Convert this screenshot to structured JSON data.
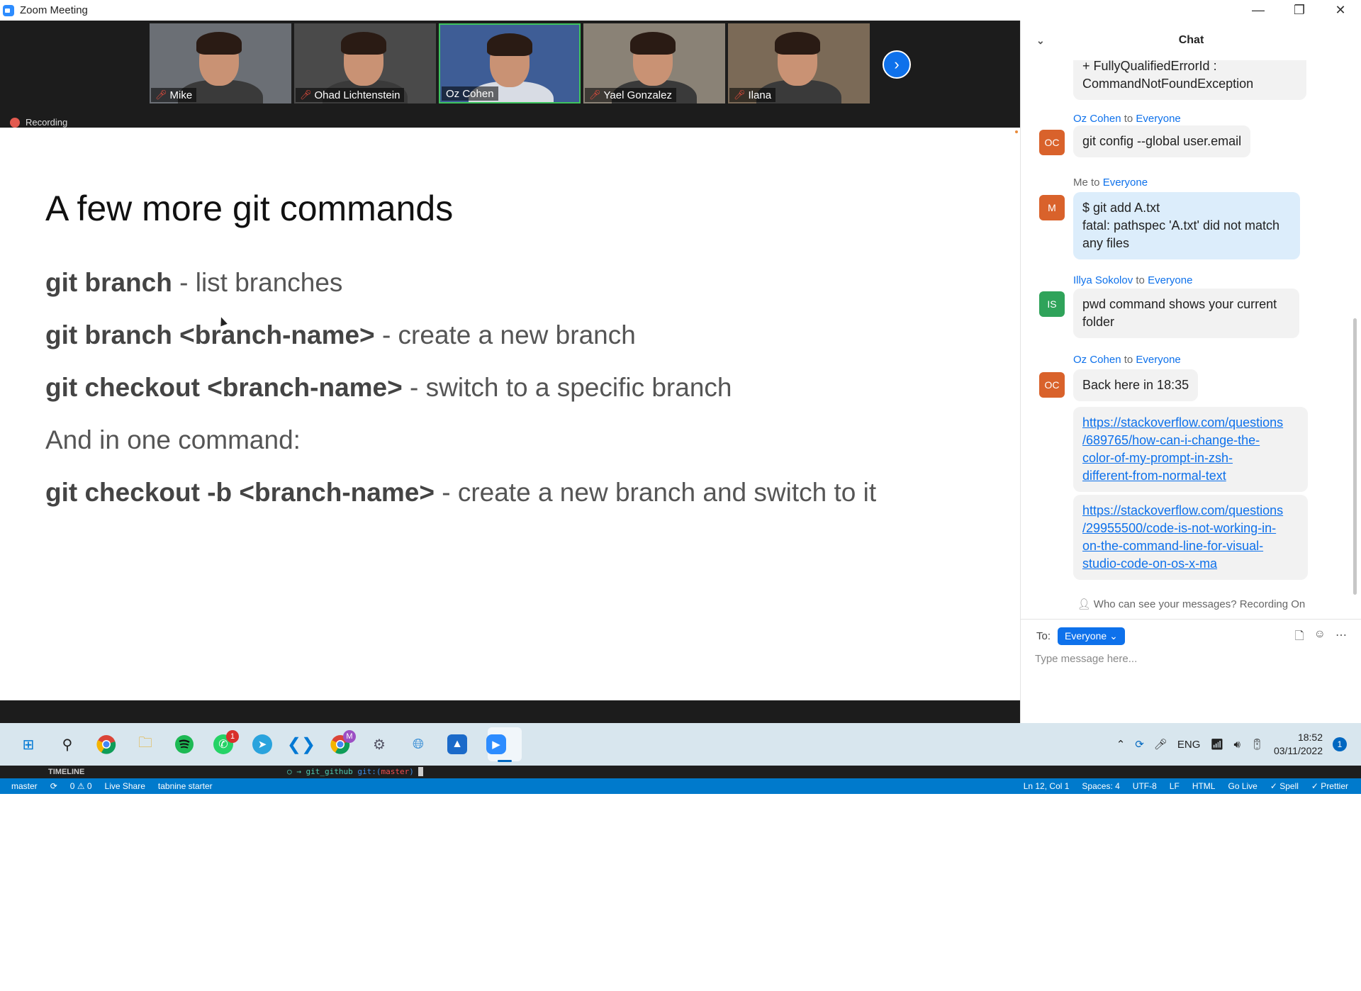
{
  "window": {
    "title": "Zoom Meeting",
    "controls": [
      "minimize",
      "maximize",
      "close"
    ]
  },
  "participants": [
    {
      "name": "Mike",
      "muted": true,
      "speaking": false,
      "bg": "#6b6f75"
    },
    {
      "name": "Ohad Lichtenstein",
      "muted": true,
      "speaking": false,
      "bg": "#4a4a4a"
    },
    {
      "name": "Oz Cohen",
      "muted": false,
      "speaking": true,
      "bg": "#3e5d96"
    },
    {
      "name": "Yael Gonzalez",
      "muted": true,
      "speaking": false,
      "bg": "#8a8276"
    },
    {
      "name": "Ilana",
      "muted": true,
      "speaking": false,
      "bg": "#7b6a57"
    }
  ],
  "recording": {
    "label": "Recording"
  },
  "slide": {
    "heading": "A few more git commands",
    "lines": [
      {
        "bold": "git branch",
        "rest": " - list branches"
      },
      {
        "bold": "git branch <branch-name>",
        "rest": " - create a new branch"
      },
      {
        "bold": "git checkout <branch-name>",
        "rest": " - switch to a specific branch"
      },
      {
        "bold": "",
        "rest": "And in one command:"
      },
      {
        "bold": "git checkout -b <branch-name>",
        "rest": " - create a new branch and switch to it"
      }
    ]
  },
  "chat": {
    "title": "Chat",
    "messages": [
      {
        "text": "+ FullyQualifiedErrorId : CommandNotFoundException",
        "kind": "partial"
      },
      {
        "sender": "Oz Cohen",
        "to_word": "to",
        "audience": "Everyone",
        "initials": "OC",
        "avatar_color": "#d9622b",
        "text": "git config --global user.email"
      },
      {
        "sender": "Me",
        "to_word": "to",
        "audience": "Everyone",
        "initials": "M",
        "avatar_color": "#d9622b",
        "text": "$ git add A.txt\nfatal: pathspec 'A.txt' did not match any files"
      },
      {
        "sender": "Illya Sokolov",
        "to_word": "to",
        "audience": "Everyone",
        "initials": "IS",
        "avatar_color": "#2fa35a",
        "text": "pwd command shows your current folder"
      },
      {
        "sender": "Oz Cohen",
        "to_word": "to",
        "audience": "Everyone",
        "initials": "OC",
        "avatar_color": "#d9622b",
        "text": "Back here in 18:35"
      },
      {
        "link": "https://stackoverflow.com/questions/689765/how-can-i-change-the-color-of-my-prompt-in-zsh-different-from-normal-text"
      },
      {
        "link": "https://stackoverflow.com/questions/29955500/code-is-not-working-in-on-the-command-line-for-visual-studio-code-on-os-x-ma"
      }
    ],
    "link_lines": [
      [
        "https://stackoverflow.com/questions",
        "/689765/how-can-i-change-the-",
        "color-of-my-prompt-in-zsh-",
        "different-from-normal-text"
      ],
      [
        "https://stackoverflow.com/questions",
        "/29955500/code-is-not-working-in-",
        "on-the-command-line-for-visual-",
        "studio-code-on-os-x-ma"
      ]
    ],
    "privacy_notice": "Who can see your messages? Recording On",
    "to_label": "To:",
    "to_value": "Everyone",
    "input_placeholder": "Type message here..."
  },
  "taskbar": {
    "apps": [
      "windows-start",
      "search",
      "chrome",
      "file-explorer",
      "spotify",
      "whatsapp",
      "telegram",
      "vscode",
      "chrome-profile",
      "settings",
      "browser",
      "photos",
      "zoom"
    ],
    "whatsapp_badge": "1",
    "chrome_profile_letter": "M",
    "tray": {
      "language": "ENG",
      "time": "18:52",
      "date": "03/11/2022",
      "notifications": "1"
    }
  },
  "vscode": {
    "timeline_label": "TIMELINE",
    "terminal_prompt": "○ → ",
    "terminal_dir": "git_github",
    "terminal_git": "git:(",
    "terminal_branch": "master",
    "terminal_close": ")",
    "status_left": [
      "master",
      "⟳",
      "0 ⚠ 0",
      "Live Share",
      "tabnine starter"
    ],
    "status_right": [
      "Ln 12, Col 1",
      "Spaces: 4",
      "UTF-8",
      "LF",
      "HTML",
      "Go Live",
      "✓ Spell",
      "✓ Prettier"
    ]
  }
}
